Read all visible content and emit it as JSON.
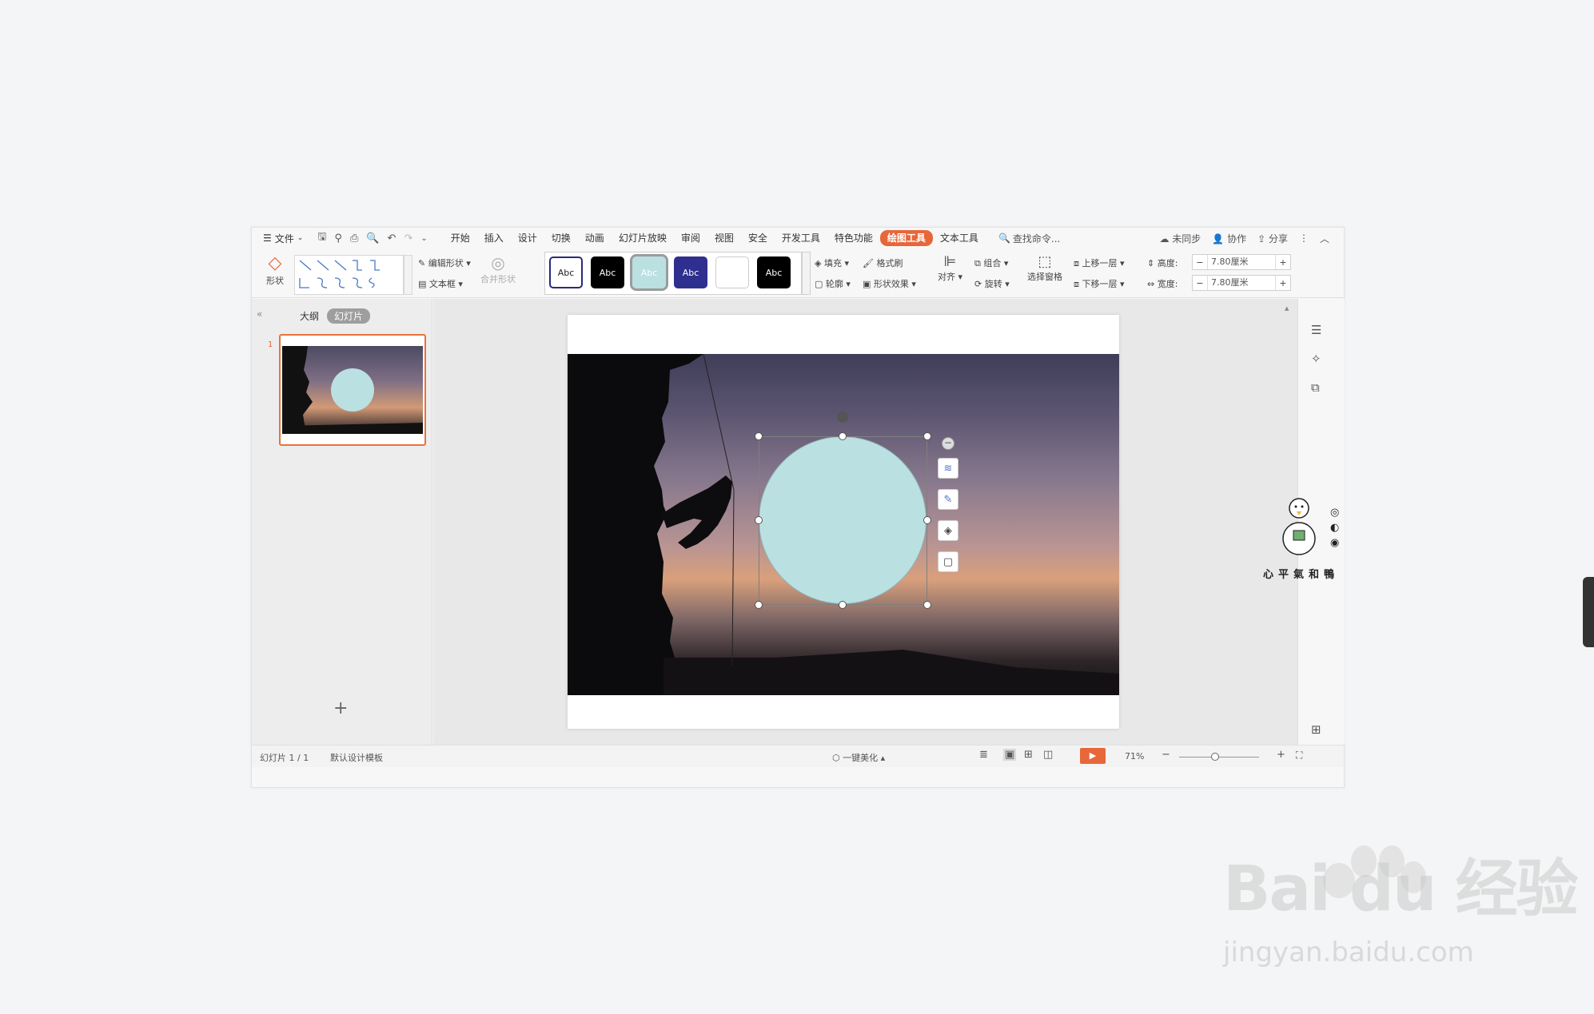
{
  "menubar": {
    "file_label": "文件",
    "tabs": [
      "开始",
      "插入",
      "设计",
      "切换",
      "动画",
      "幻灯片放映",
      "审阅",
      "视图",
      "安全",
      "开发工具",
      "特色功能",
      "绘图工具",
      "文本工具"
    ],
    "active_tab": "绘图工具",
    "search_label": "查找命令...",
    "sync_label": "未同步",
    "collab_label": "协作",
    "share_label": "分享"
  },
  "toolbar": {
    "shape_label": "形状",
    "edit_shape_label": "编辑形状",
    "textbox_label": "文本框",
    "merge_shape_label": "合并形状",
    "style_chip_text": "Abc",
    "fill_label": "填充",
    "outline_label": "轮廓",
    "format_brush_label": "格式刷",
    "shape_effect_label": "形状效果",
    "align_label": "对齐",
    "group_label": "组合",
    "rotate_label": "旋转",
    "selection_pane_label": "选择窗格",
    "bring_forward_label": "上移一层",
    "send_backward_label": "下移一层",
    "height_label": "高度:",
    "width_label": "宽度:",
    "height_value": "7.80厘米",
    "width_value": "7.80厘米",
    "minus": "−",
    "plus": "+"
  },
  "left_pane": {
    "collapse": "«",
    "tab_outline": "大纲",
    "tab_slides": "幻灯片",
    "slide_number": "1",
    "add_slide": "+"
  },
  "status": {
    "slide_info": "幻灯片 1 / 1",
    "template": "默认设计模板",
    "beautify": "一键美化",
    "zoom": "71%"
  },
  "watermark": {
    "brand": "Bai du 经验",
    "url": "jingyan.baidu.com",
    "duck_caption": "心平氣和鴨"
  },
  "colors": {
    "accent": "#e8673a",
    "circle_fill": "#bae0e2"
  }
}
